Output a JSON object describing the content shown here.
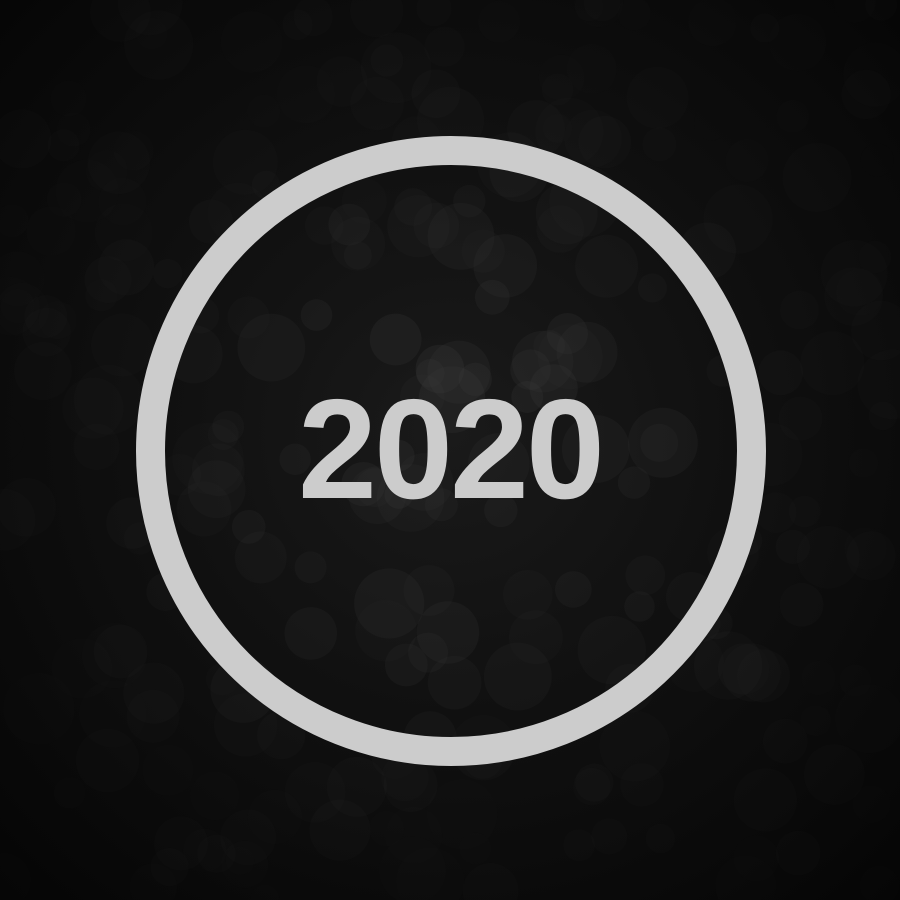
{
  "year": "2020",
  "colors": {
    "background": "#0a0a0a",
    "ring": "#cccccc",
    "text": "#cccccc",
    "bokeh": "#3a3a3a"
  }
}
